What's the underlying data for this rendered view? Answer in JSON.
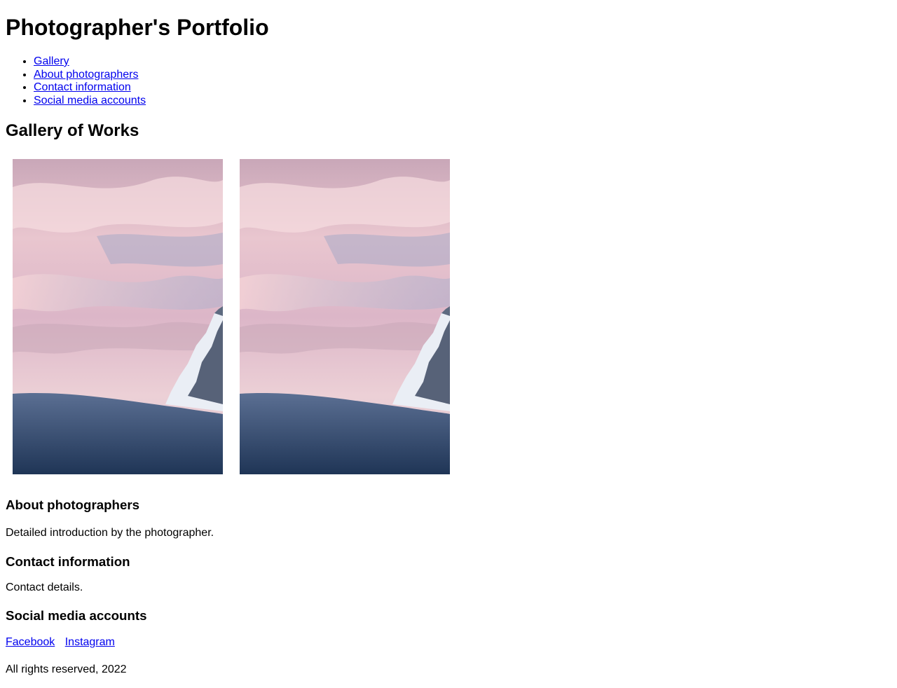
{
  "header": {
    "title": "Photographer's Portfolio"
  },
  "nav": {
    "items": [
      {
        "label": "Gallery"
      },
      {
        "label": "About photographers"
      },
      {
        "label": "Contact information"
      },
      {
        "label": "Social media accounts"
      }
    ]
  },
  "gallery": {
    "heading": "Gallery of Works",
    "images": [
      {
        "subject": "snowy-mountain-sunset-photo"
      },
      {
        "subject": "snowy-mountain-sunset-photo"
      }
    ]
  },
  "about": {
    "heading": "About photographers",
    "text": "Detailed introduction by the photographer."
  },
  "contact": {
    "heading": "Contact information",
    "text": "Contact details."
  },
  "social": {
    "heading": "Social media accounts",
    "links": [
      {
        "label": "Facebook"
      },
      {
        "label": "Instagram"
      }
    ]
  },
  "footer": {
    "text": "All rights reserved, 2022"
  },
  "colors": {
    "link": "#0000ee",
    "text": "#000000",
    "background": "#ffffff"
  }
}
